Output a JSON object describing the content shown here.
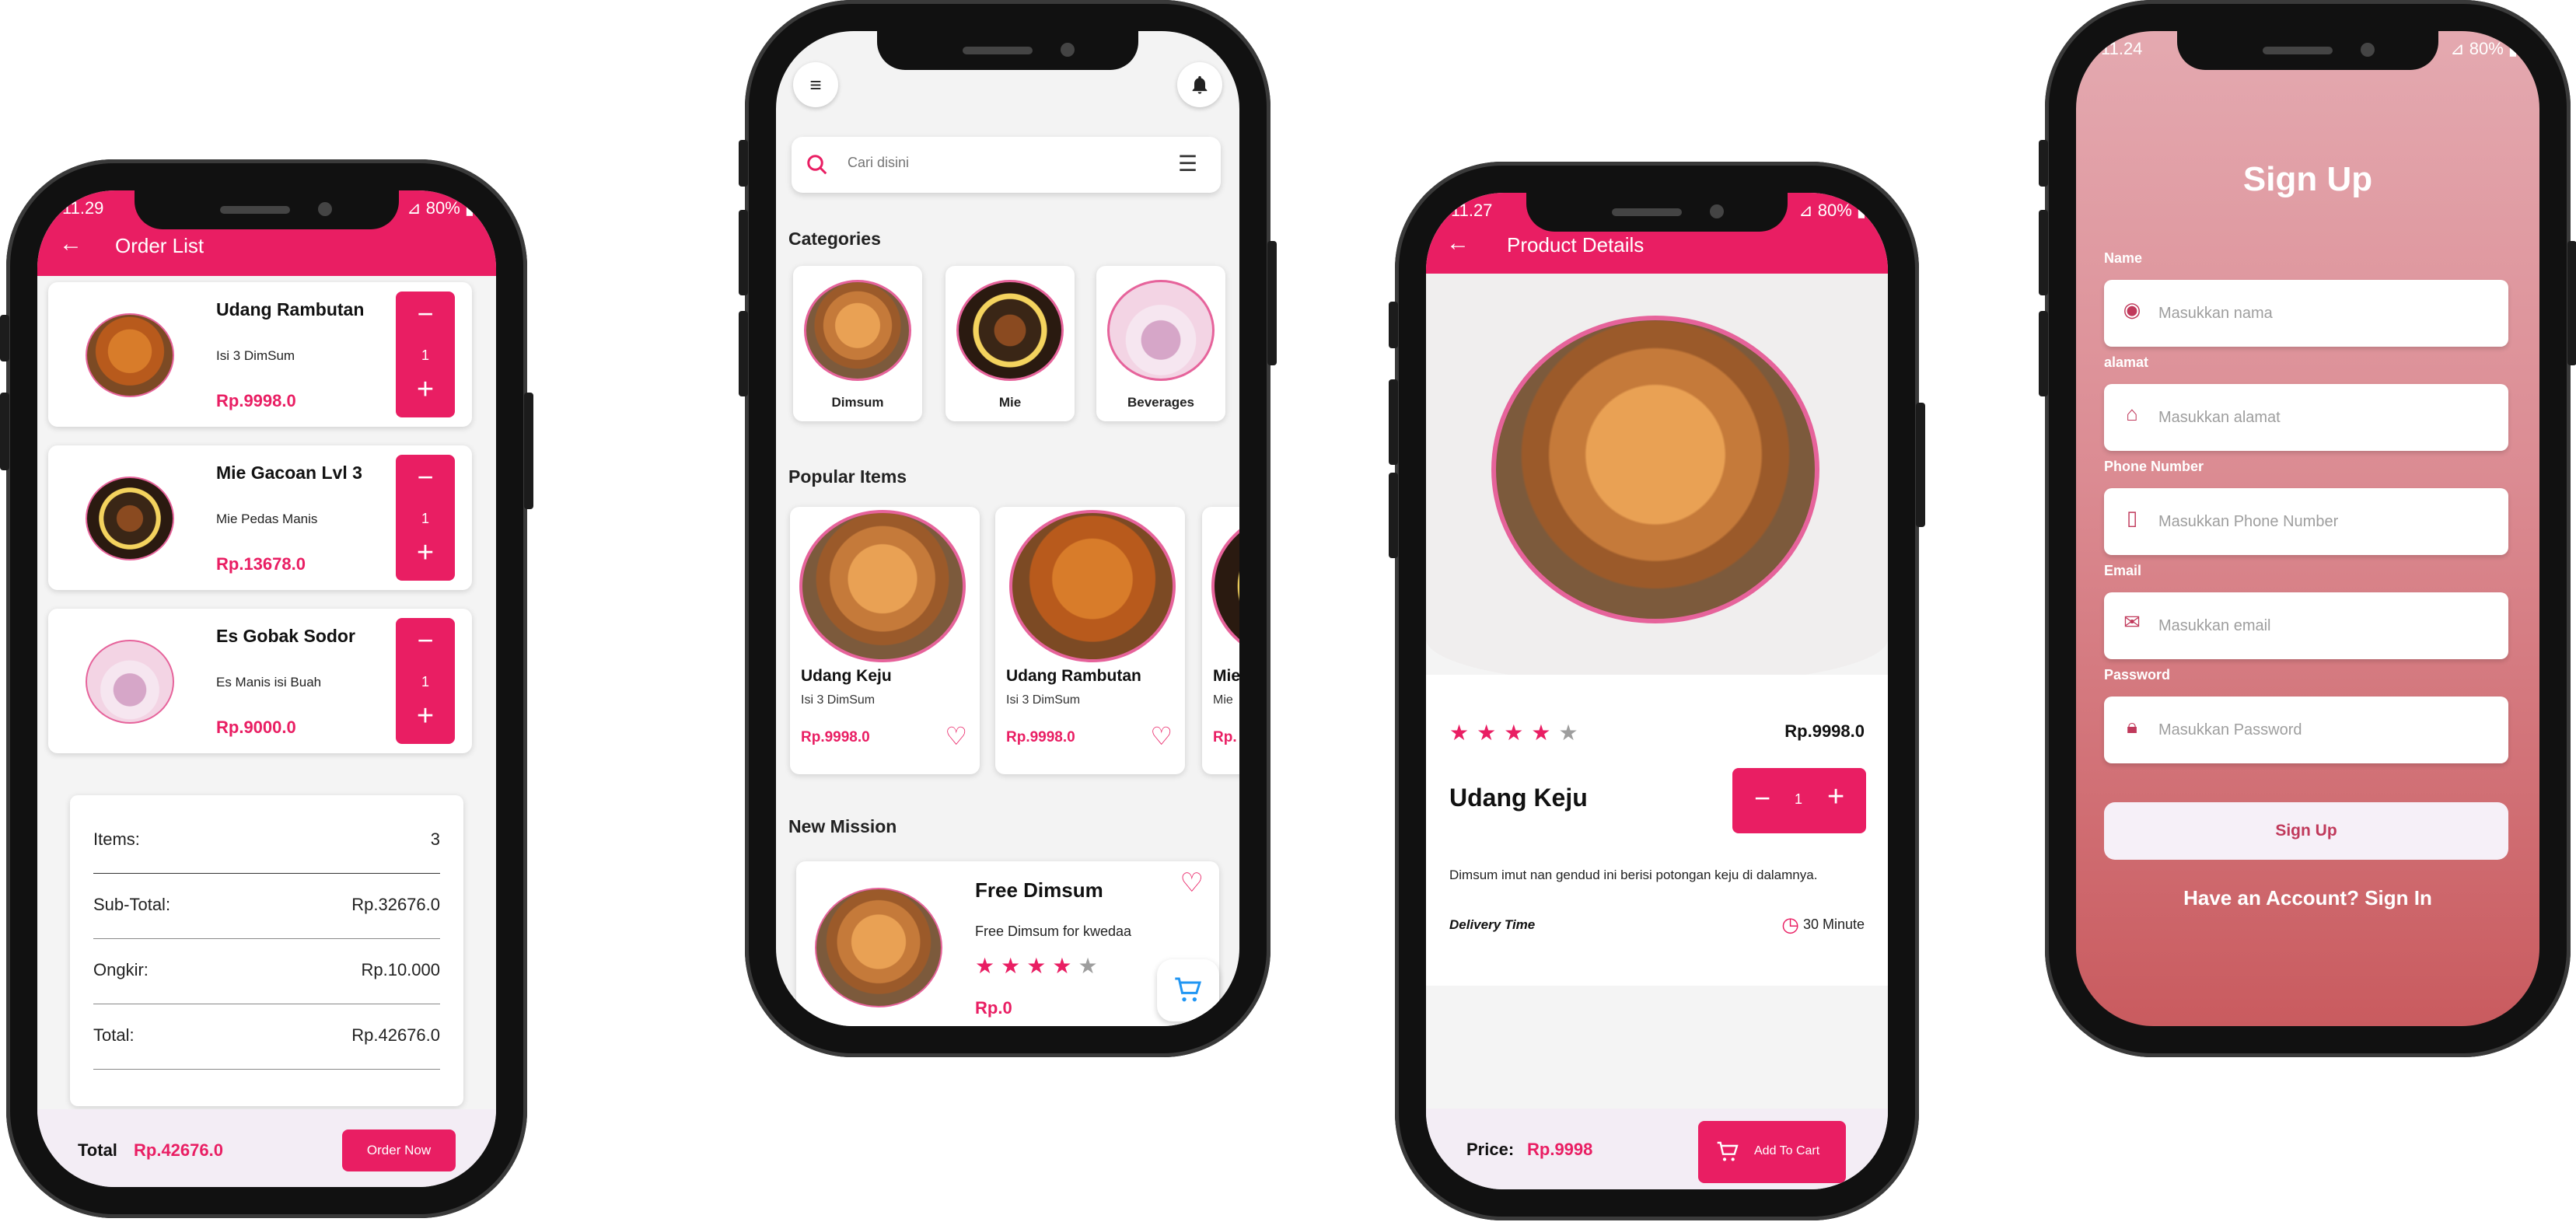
{
  "status": {
    "p1_time": "11.29",
    "p3_time": "11.27",
    "p4_time": "11.24",
    "battery": "80%"
  },
  "order_list": {
    "title": "Order List",
    "items": [
      {
        "name": "Udang Rambutan",
        "desc": "Isi 3 DimSum",
        "price": "Rp.9998.0",
        "qty": "1",
        "image": "udang-rambutan"
      },
      {
        "name": "Mie Gacoan Lvl 3",
        "desc": "Mie Pedas Manis",
        "price": "Rp.13678.0",
        "qty": "1",
        "image": "mie-gacoan"
      },
      {
        "name": "Es Gobak Sodor",
        "desc": "Es Manis isi Buah",
        "price": "Rp.9000.0",
        "qty": "1",
        "image": "es-gobak-sodor"
      }
    ],
    "summary": {
      "items_label": "Items:",
      "items_value": "3",
      "subtotal_label": "Sub-Total:",
      "subtotal_value": "Rp.32676.0",
      "ongkir_label": "Ongkir:",
      "ongkir_value": "Rp.10.000",
      "total_label": "Total:",
      "total_value": "Rp.42676.0"
    },
    "footer": {
      "total_label": "Total",
      "total_value": "Rp.42676.0",
      "order_button": "Order Now"
    }
  },
  "home": {
    "search_placeholder": "Cari disini",
    "categories_title": "Categories",
    "categories": [
      {
        "label": "Dimsum"
      },
      {
        "label": "Mie"
      },
      {
        "label": "Beverages"
      }
    ],
    "popular_title": "Popular Items",
    "popular": [
      {
        "name": "Udang Keju",
        "desc": "Isi 3 DimSum",
        "price": "Rp.9998.0"
      },
      {
        "name": "Udang Rambutan",
        "desc": "Isi 3 DimSum",
        "price": "Rp.9998.0"
      },
      {
        "name": "Mie",
        "desc": "Mie",
        "price": "Rp."
      }
    ],
    "mission_title": "New Mission",
    "mission": {
      "name": "Free Dimsum",
      "desc": "Free Dimsum for kwedaa",
      "price": "Rp.0",
      "rating": 4
    }
  },
  "product": {
    "title": "Product Details",
    "name": "Udang Keju",
    "price": "Rp.9998.0",
    "rating": 4,
    "qty": "1",
    "description": "Dimsum imut nan gendud ini berisi potongan keju di dalamnya.",
    "delivery_label": "Delivery Time",
    "delivery_value": "30 Minute",
    "footer_price_label": "Price:",
    "footer_price_value": "Rp.9998",
    "add_to_cart": "Add To Cart"
  },
  "signup": {
    "title": "Sign Up",
    "fields": [
      {
        "label": "Name",
        "placeholder": "Masukkan nama",
        "icon": "person-icon"
      },
      {
        "label": "alamat",
        "placeholder": "Masukkan alamat",
        "icon": "home-icon"
      },
      {
        "label": "Phone Number",
        "placeholder": "Masukkan Phone Number",
        "icon": "phone-icon"
      },
      {
        "label": "Email",
        "placeholder": "Masukkan email",
        "icon": "mail-icon"
      },
      {
        "label": "Password",
        "placeholder": "Masukkan Password",
        "icon": "lock-icon"
      }
    ],
    "button": "Sign Up",
    "have_account": "Have an Account?",
    "sign_in": "Sign In"
  },
  "colors": {
    "accent": "#e91e63",
    "signup_top": "#e4a9b0",
    "signup_bottom": "#c95b5f"
  }
}
